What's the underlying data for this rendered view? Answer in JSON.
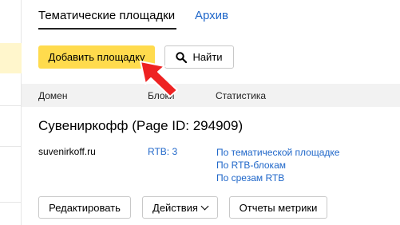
{
  "tabs": {
    "active": "Тематические площадки",
    "archive": "Архив"
  },
  "toolbar": {
    "add_label": "Добавить площадку",
    "find_label": "Найти"
  },
  "table": {
    "headers": {
      "domain": "Домен",
      "blocks": "Блоки",
      "stats": "Статистика"
    }
  },
  "site": {
    "title": "Сувениркофф (Page ID: 294909)",
    "domain": "suvenirkoff.ru",
    "rtb": "RTB: 3",
    "stats_links": [
      "По тематической площадке",
      "По RTB-блокам",
      "По срезам RTB"
    ]
  },
  "actions": {
    "edit": "Редактировать",
    "actions": "Действия",
    "metrics": "Отчеты метрики"
  },
  "colors": {
    "accent_yellow": "#ffdb4d",
    "link_blue": "#1e66c9",
    "arrow_red": "#ee2222"
  },
  "icons": [
    "search-icon",
    "chevron-down-icon",
    "pointer-arrow"
  ]
}
